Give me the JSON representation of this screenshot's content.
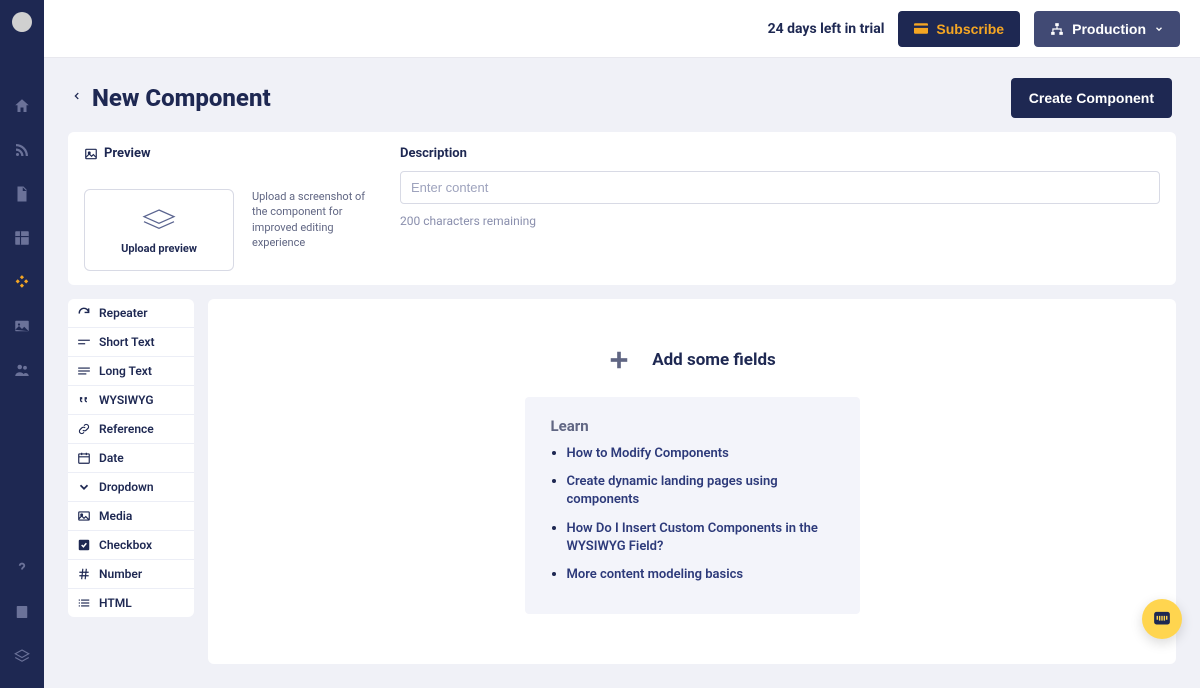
{
  "header": {
    "trial_text": "24 days left in trial",
    "subscribe_label": "Subscribe",
    "env_label": "Production"
  },
  "titlebar": {
    "page_title": "New Component",
    "create_label": "Create Component"
  },
  "preview": {
    "label": "Preview",
    "upload_text": "Upload preview",
    "hint": "Upload a screenshot of the component for improved editing experience"
  },
  "description": {
    "label": "Description",
    "placeholder": "Enter content",
    "char_count": "200 characters remaining"
  },
  "field_types": [
    {
      "label": "Repeater"
    },
    {
      "label": "Short Text"
    },
    {
      "label": "Long Text"
    },
    {
      "label": "WYSIWYG"
    },
    {
      "label": "Reference"
    },
    {
      "label": "Date"
    },
    {
      "label": "Dropdown"
    },
    {
      "label": "Media"
    },
    {
      "label": "Checkbox"
    },
    {
      "label": "Number"
    },
    {
      "label": "HTML"
    }
  ],
  "canvas": {
    "heading": "Add some fields"
  },
  "learn": {
    "title": "Learn",
    "links": [
      "How to Modify Components",
      "Create dynamic landing pages using components",
      "How Do I Insert Custom Components in the WYSIWYG Field?",
      "More content modeling basics"
    ]
  }
}
